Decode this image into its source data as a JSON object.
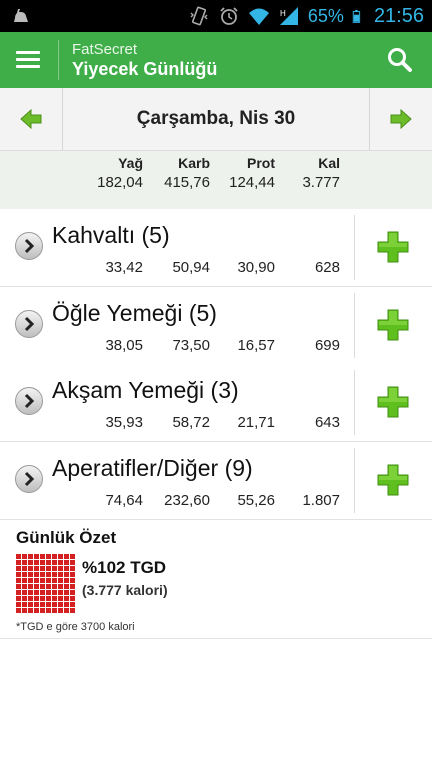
{
  "status_bar": {
    "battery_percent": "65%",
    "time": "21:56",
    "color": "#33b5e5",
    "icons": [
      "notification-icon",
      "vibrate-icon",
      "alarm-icon",
      "wifi-icon",
      "signal-icon",
      "battery-icon"
    ]
  },
  "app_bar": {
    "app_name": "FatSecret",
    "title": "Yiyecek Günlüğü",
    "color": "#3fae49",
    "icons": [
      "menu-icon",
      "search-icon"
    ]
  },
  "date_nav": {
    "date": "Çarşamba, Nis 30",
    "icons": [
      "arrow-left-icon",
      "arrow-right-icon"
    ]
  },
  "totals": {
    "headers": [
      "Yağ",
      "Karb",
      "Prot",
      "Kal"
    ],
    "values": [
      "182,04",
      "415,76",
      "124,44",
      "3.777"
    ]
  },
  "meals": [
    {
      "title": "Kahvaltı (5)",
      "values": [
        "33,42",
        "50,94",
        "30,90",
        "628"
      ]
    },
    {
      "title": "Öğle Yemeği (5)",
      "values": [
        "38,05",
        "73,50",
        "16,57",
        "699"
      ]
    },
    {
      "title": "Akşam Yemeği (3)",
      "values": [
        "35,93",
        "58,72",
        "21,71",
        "643"
      ]
    },
    {
      "title": "Aperatifler/Diğer (9)",
      "values": [
        "74,64",
        "232,60",
        "55,26",
        "1.807"
      ]
    }
  ],
  "summary": {
    "title": "Günlük Özet",
    "rdi": "%102 TGD",
    "calories": "(3.777 kalori)",
    "footnote": "*TGD e göre 3700 kalori",
    "grid_color": "#d42020"
  }
}
